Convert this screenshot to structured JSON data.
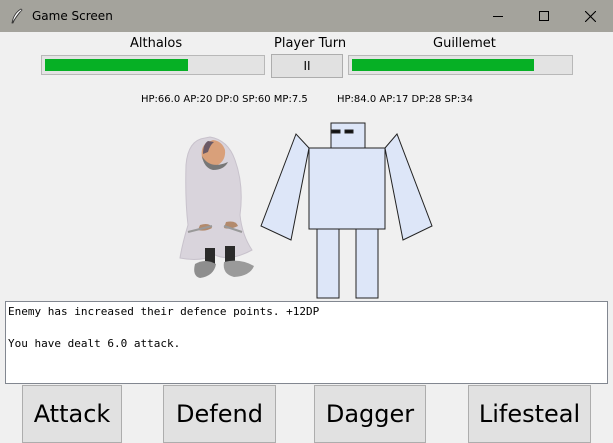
{
  "window": {
    "title": "Game Screen",
    "controls": [
      "minimize-icon",
      "maximize-icon",
      "close-icon"
    ]
  },
  "player": {
    "name": "Althalos",
    "hp_fraction": 0.66,
    "stats": "HP:66.0 AP:20 DP:0 SP:60 MP:7.5"
  },
  "turn": {
    "label": "Player Turn",
    "pause_label": "II"
  },
  "enemy": {
    "name": "Guillemet",
    "hp_fraction": 0.84,
    "stats": "HP:84.0 AP:17 DP:28 SP:34"
  },
  "log": {
    "lines": [
      "Enemy has increased their defence points. +12DP",
      "",
      "You have dealt 6.0 attack."
    ]
  },
  "actions": [
    {
      "label": "Attack"
    },
    {
      "label": "Defend"
    },
    {
      "label": "Dagger"
    },
    {
      "label": "Lifesteal"
    }
  ],
  "colors": {
    "hp_fill": "#06b025",
    "titlebar": "#a4a39c",
    "robot_fill": "#dde6f8",
    "cloak": "#d9d4dc"
  }
}
